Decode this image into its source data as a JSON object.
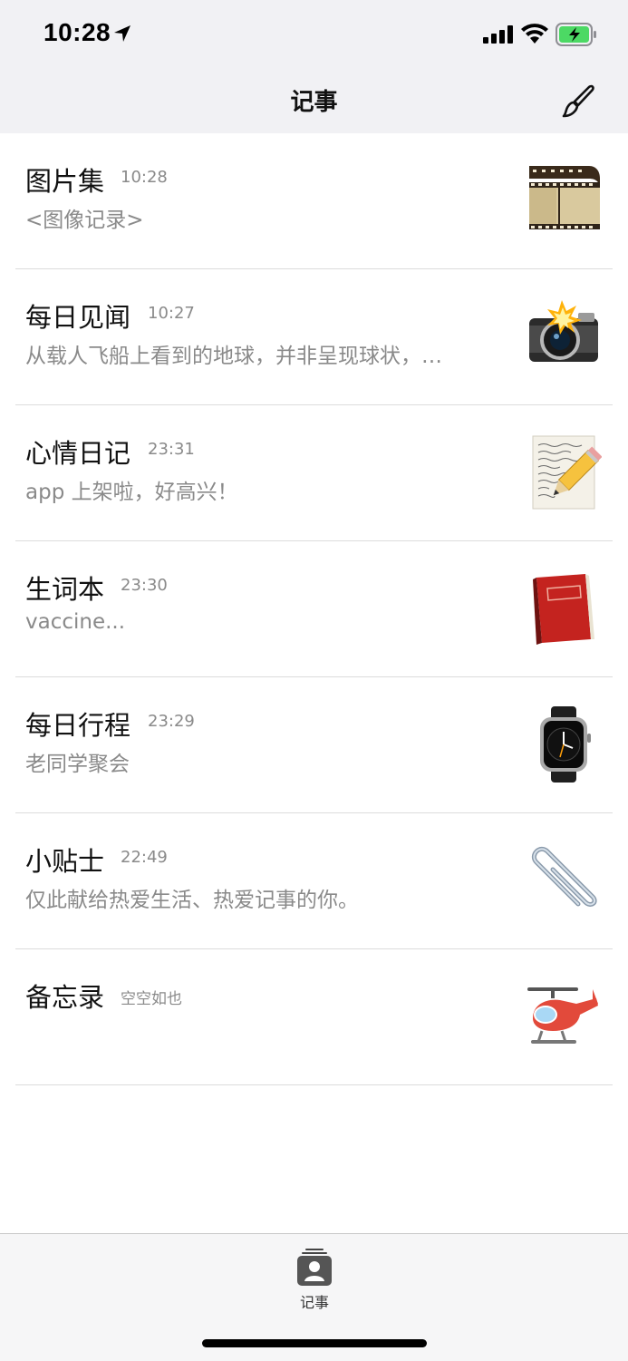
{
  "status_bar": {
    "time": "10:28"
  },
  "nav": {
    "title": "记事"
  },
  "notes": [
    {
      "title": "图片集",
      "time": "10:28",
      "subtitle": "<图像记录>",
      "icon": "film-strip-icon"
    },
    {
      "title": "每日见闻",
      "time": "10:27",
      "subtitle": "从载人飞船上看到的地球，并非呈现球状，…",
      "icon": "camera-flash-icon"
    },
    {
      "title": "心情日记",
      "time": "23:31",
      "subtitle": "app 上架啦，好高兴！",
      "icon": "memo-pencil-icon"
    },
    {
      "title": "生词本",
      "time": "23:30",
      "subtitle": "vaccine...",
      "icon": "red-book-icon"
    },
    {
      "title": "每日行程",
      "time": "23:29",
      "subtitle": "老同学聚会",
      "icon": "watch-icon"
    },
    {
      "title": "小贴士",
      "time": "22:49",
      "subtitle": "仅此献给热爱生活、热爱记事的你。",
      "icon": "paperclip-icon"
    },
    {
      "title": "备忘录",
      "time": "空空如也",
      "subtitle": "",
      "icon": "helicopter-icon"
    }
  ],
  "tab_bar": {
    "items": [
      {
        "label": "记事",
        "icon": "notes-contact-icon"
      }
    ]
  },
  "colors": {
    "bar_bg": "#f1f1f4",
    "battery_green": "#4cd964",
    "divider": "#dcdcdc"
  }
}
